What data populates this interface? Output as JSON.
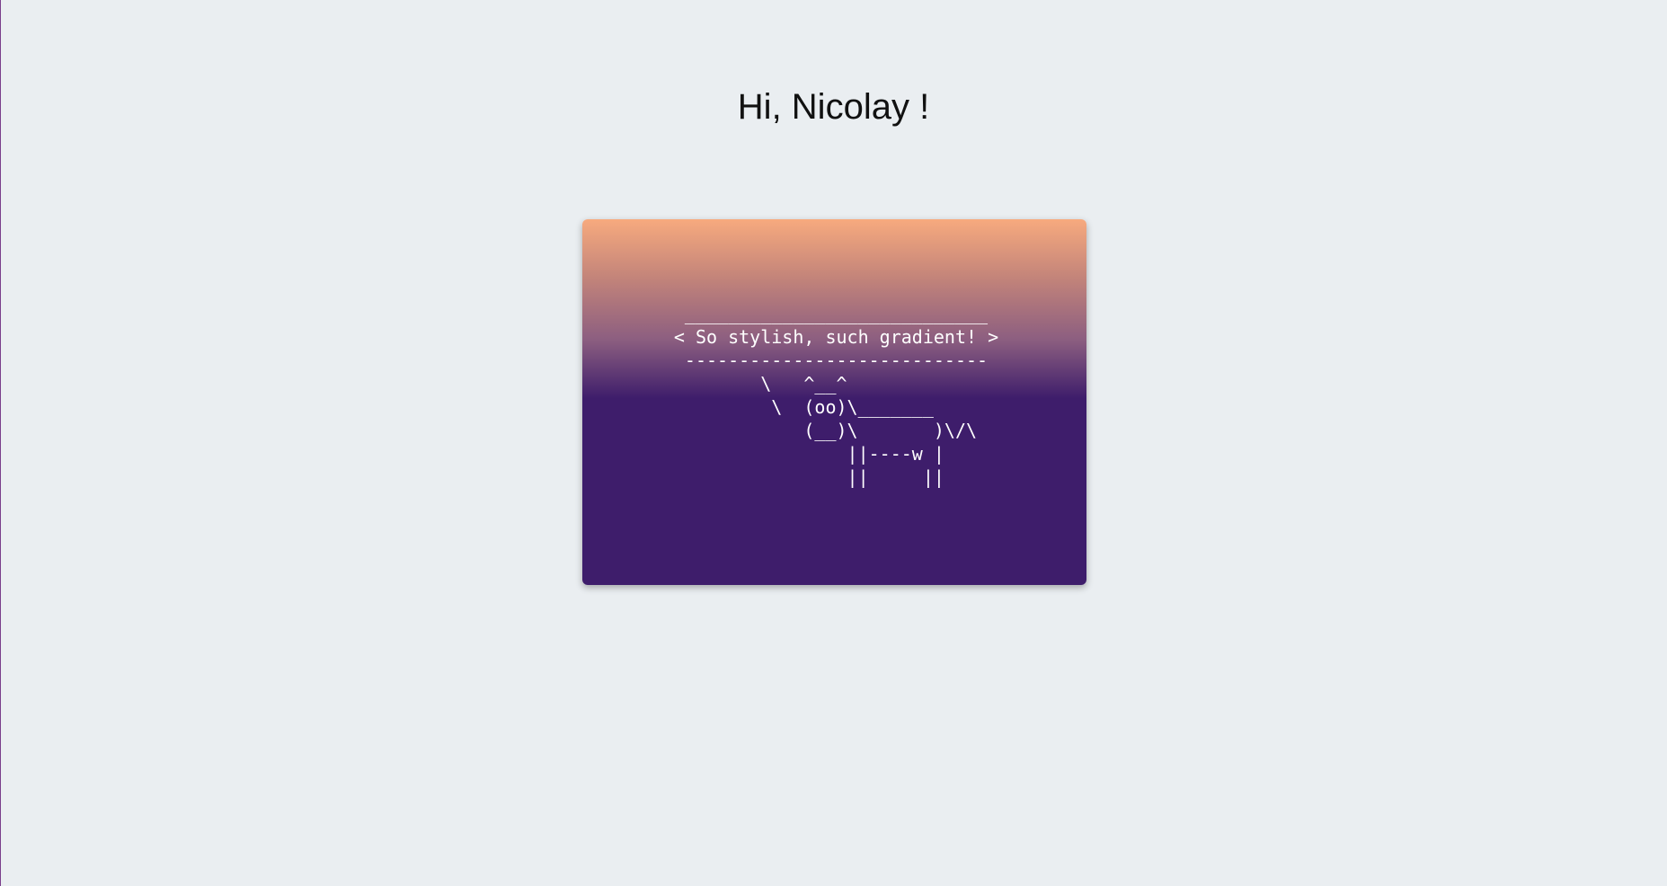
{
  "greeting": {
    "text": "Hi, Nicolay !"
  },
  "card": {
    "gradient_colors": [
      "#f7aa7e",
      "#c3847a",
      "#8c5e80",
      "#3e1d6b"
    ],
    "cowsay_art": " ____________________________\n< So stylish, such gradient! >\n ----------------------------\n        \\   ^__^\n         \\  (oo)\\_______\n            (__)\\       )\\/\\\n                ||----w |\n                ||     ||"
  },
  "page": {
    "background_color": "#eaeef1",
    "edge_color": "#7a3f8c"
  }
}
